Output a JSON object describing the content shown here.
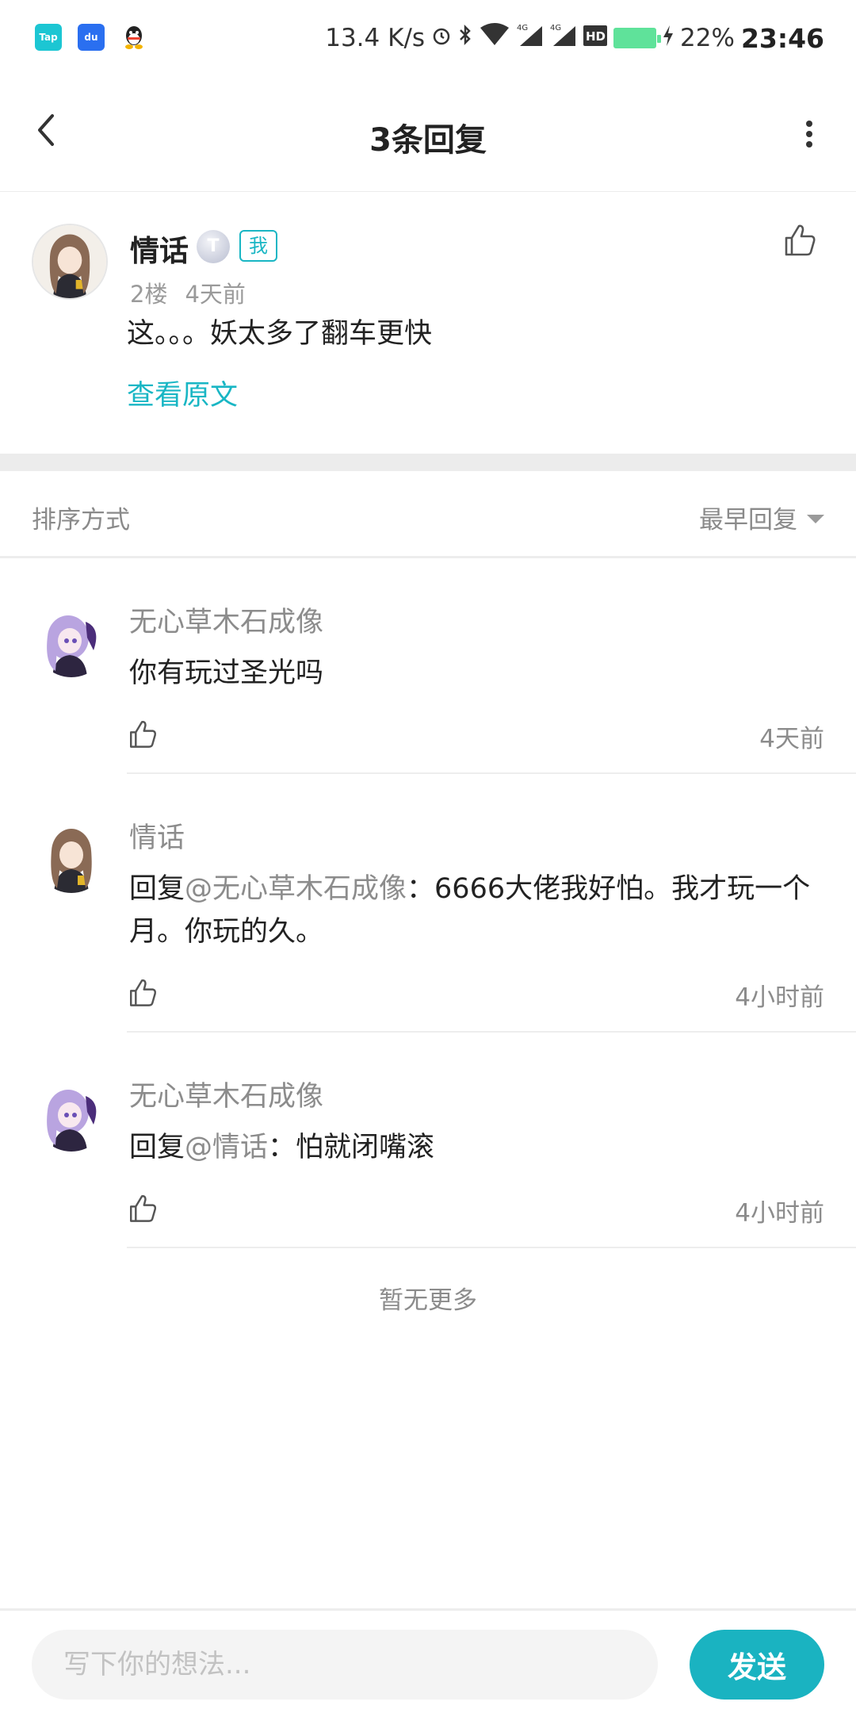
{
  "status_bar": {
    "apps": [
      {
        "icon": "taptap-icon",
        "label": "Tap",
        "color": "#1cc6d3"
      },
      {
        "icon": "baidu-icon",
        "label": "du",
        "color": "#2a6ff0"
      },
      {
        "icon": "qq-icon",
        "label": "",
        "color": "#222222"
      }
    ],
    "net_speed": "13.4 K/s",
    "battery": "22%",
    "time": "23:46"
  },
  "header": {
    "title": "3条回复"
  },
  "main_post": {
    "author": "情话",
    "level": "T",
    "me_badge": "我",
    "floor": "2楼",
    "time": "4天前",
    "text": "这。。。妖太多了翻车更快",
    "view_original": "查看原文"
  },
  "sort": {
    "label": "排序方式",
    "selected": "最早回复"
  },
  "replies": [
    {
      "author": "无心草木石成像",
      "prefix": "",
      "mention": "",
      "text": "你有玩过圣光吗",
      "time": "4天前",
      "avatar": "purple"
    },
    {
      "author": "情话",
      "prefix": "回复",
      "mention": "@无心草木石成像",
      "text": "：6666大佬我好怕。我才玩一个月。你玩的久。",
      "time": "4小时前",
      "avatar": "brown"
    },
    {
      "author": "无心草木石成像",
      "prefix": "回复",
      "mention": "@情话",
      "text": "：怕就闭嘴滚",
      "time": "4小时前",
      "avatar": "purple"
    }
  ],
  "footer_note": "暂无更多",
  "input": {
    "placeholder": "写下你的想法...",
    "send_label": "发送"
  },
  "colors": {
    "accent": "#19b6c4",
    "muted_text": "#8c8c8c"
  }
}
